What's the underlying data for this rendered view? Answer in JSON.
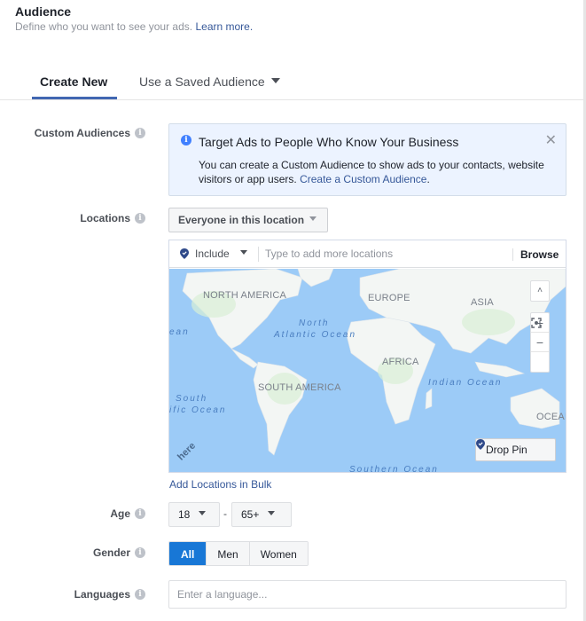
{
  "header": {
    "title": "Audience",
    "subtitle": "Define who you want to see your ads.",
    "learn_more": "Learn more."
  },
  "tabs": [
    {
      "label": "Create New",
      "active": true
    },
    {
      "label": "Use a Saved Audience",
      "active": false
    }
  ],
  "custom_audiences": {
    "label": "Custom Audiences",
    "notice_title": "Target Ads to People Who Know Your Business",
    "notice_body": "You can create a Custom Audience to show ads to your contacts, website visitors or app users.",
    "notice_link": "Create a Custom Audience",
    "notice_period": ".",
    "close_glyph": "✕"
  },
  "locations": {
    "label": "Locations",
    "scope_dropdown": "Everyone in this location",
    "include_label": "Include",
    "search_placeholder": "Type to add more locations",
    "browse_label": "Browse",
    "add_bulk": "Add Locations in Bulk",
    "map": {
      "continents": [
        "NORTH AMERICA",
        "EUROPE",
        "ASIA",
        "AFRICA",
        "SOUTH AMERICA",
        "OCEANIA"
      ],
      "oceans": [
        "North Atlantic Ocean",
        "Indian Ocean",
        "South Pacific Ocean",
        "Pacific Ocean",
        "Southern Ocean"
      ],
      "oceania_clipped": "OCEAN",
      "na": "NORTH AMERICA",
      "eu": "EUROPE",
      "as": "ASIA",
      "af": "AFRICA",
      "sa": "SOUTH AMERICA",
      "north": "North",
      "atlantic": "Atlantic Ocean",
      "indian": "Indian Ocean",
      "south": "South",
      "pacific": "ific Ocean",
      "pac_left": "ean",
      "southern": "Southern Ocean",
      "attribution": "here",
      "controls": {
        "up": "˄",
        "zoom_in": "+",
        "zoom_out": "−"
      },
      "drop_pin": "Drop Pin"
    }
  },
  "age": {
    "label": "Age",
    "min": "18",
    "max": "65+",
    "separator": "-"
  },
  "gender": {
    "label": "Gender",
    "options": [
      "All",
      "Men",
      "Women"
    ],
    "selected": "All"
  },
  "languages": {
    "label": "Languages",
    "placeholder": "Enter a language..."
  },
  "info_glyph": "i",
  "colors": {
    "accent": "#4267b2",
    "link": "#365899",
    "selected": "#1877d6",
    "notice_bg": "#ecf3ff",
    "ocean": "#9ccbf7"
  }
}
